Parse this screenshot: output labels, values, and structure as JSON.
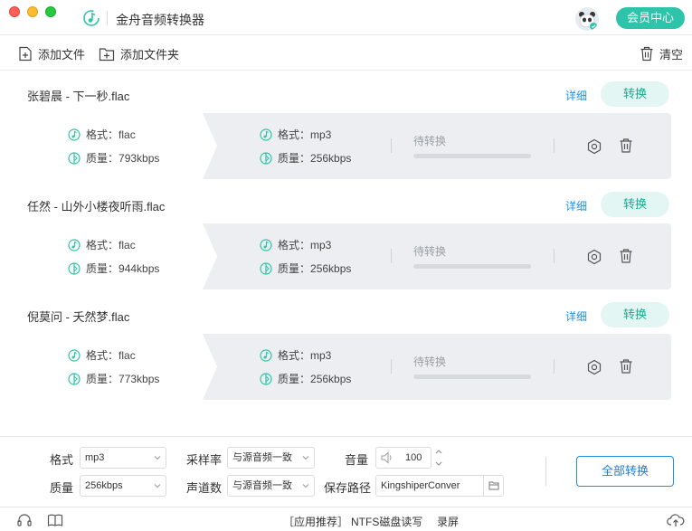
{
  "app": {
    "title": "金舟音频转换器",
    "vip_label": "会员中心",
    "accent_color": "#2ec4a9",
    "link_color": "#1e90e8"
  },
  "toolbar": {
    "add_file": "添加文件",
    "add_folder": "添加文件夹",
    "clear": "清空"
  },
  "files": [
    {
      "name": "张碧晨 - 下一秒.flac",
      "detail": "详细",
      "convert": "转换",
      "src_format_label": "格式：",
      "src_format": "flac",
      "src_quality_label": "质量：",
      "src_quality": "793kbps",
      "dst_format_label": "格式：",
      "dst_format": "mp3",
      "dst_quality_label": "质量：",
      "dst_quality": "256kbps",
      "status": "待转换",
      "progress": 0
    },
    {
      "name": "任然 - 山外小楼夜听雨.flac",
      "detail": "详细",
      "convert": "转换",
      "src_format_label": "格式：",
      "src_format": "flac",
      "src_quality_label": "质量：",
      "src_quality": "944kbps",
      "dst_format_label": "格式：",
      "dst_format": "mp3",
      "dst_quality_label": "质量：",
      "dst_quality": "256kbps",
      "status": "待转换",
      "progress": 0
    },
    {
      "name": "倪莫问 - 夭然梦.flac",
      "detail": "详细",
      "convert": "转换",
      "src_format_label": "格式：",
      "src_format": "flac",
      "src_quality_label": "质量：",
      "src_quality": "773kbps",
      "dst_format_label": "格式：",
      "dst_format": "mp3",
      "dst_quality_label": "质量：",
      "dst_quality": "256kbps",
      "status": "待转换",
      "progress": 0
    }
  ],
  "settings": {
    "format_label": "格式",
    "format_value": "mp3",
    "quality_label": "质量",
    "quality_value": "256kbps",
    "samplerate_label": "采样率",
    "samplerate_value": "与源音频一致",
    "channels_label": "声道数",
    "channels_value": "与源音频一致",
    "volume_label": "音量",
    "volume_value": "100",
    "savepath_label": "保存路径",
    "savepath_value": "KingshiperConver",
    "convert_all": "全部转换"
  },
  "footer": {
    "recommend": "［应用推荐］",
    "ntfs": "NTFS磁盘读写",
    "record": "录屏"
  }
}
